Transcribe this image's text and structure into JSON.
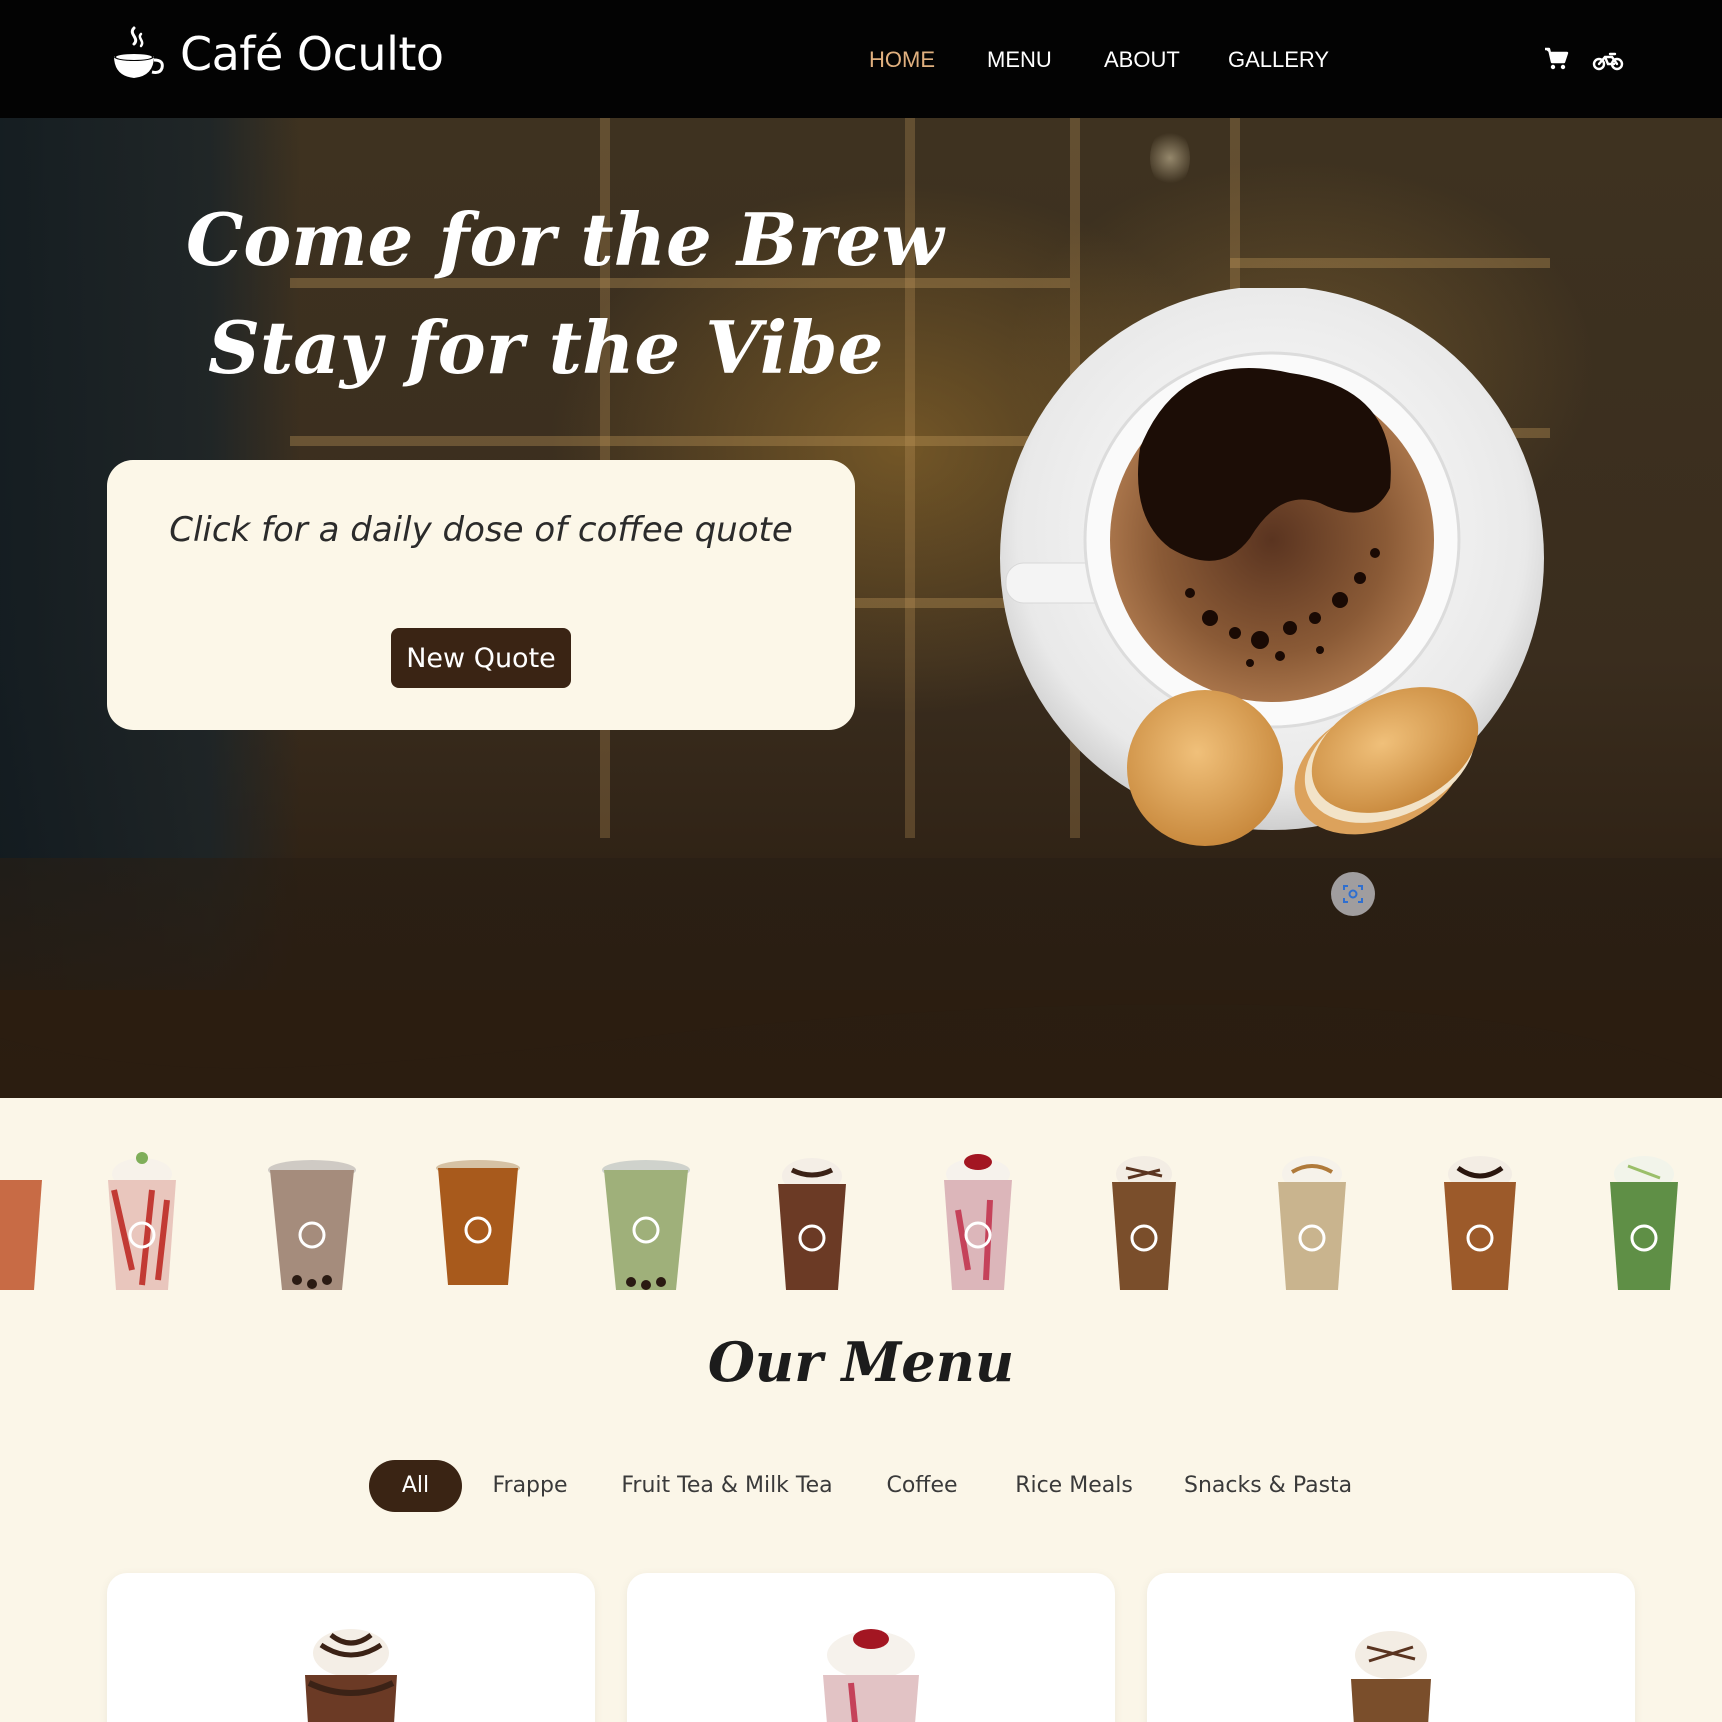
{
  "brand": {
    "name": "Café Oculto",
    "logo_icon": "coffee-cup-steam-icon"
  },
  "nav": {
    "items": [
      {
        "label": "HOME",
        "active": true
      },
      {
        "label": "MENU",
        "active": false
      },
      {
        "label": "ABOUT",
        "active": false
      },
      {
        "label": "GALLERY",
        "active": false
      }
    ],
    "icons": [
      "cart-icon",
      "motorcycle-icon"
    ]
  },
  "hero": {
    "title_line1": "Come for the Brew",
    "title_line2": "Stay for the Vibe",
    "quote_text": "Click for a daily dose of coffee quote",
    "quote_button": "New Quote",
    "image": "coffee-cup-with-cookies",
    "scan_icon": "visual-search-icon"
  },
  "drinks_strip": {
    "items": [
      "strawberry-frappe",
      "milk-tea-pearls",
      "fruit-tea",
      "matcha-milk-tea-pearls",
      "chocolate-frappe",
      "strawberry-cream-frappe",
      "mocha-frappe",
      "caramel-frappe",
      "java-chip-frappe",
      "matcha-frappe"
    ]
  },
  "menu": {
    "title": "Our Menu",
    "filters": [
      {
        "label": "All",
        "active": true
      },
      {
        "label": "Frappe",
        "active": false
      },
      {
        "label": "Fruit Tea & Milk Tea",
        "active": false
      },
      {
        "label": "Coffee",
        "active": false
      },
      {
        "label": "Rice Meals",
        "active": false
      },
      {
        "label": "Snacks & Pasta",
        "active": false
      }
    ],
    "cards": [
      "chocolate-frappe",
      "strawberry-frappe",
      "mocha-frappe"
    ]
  },
  "colors": {
    "nav_bg": "#030303",
    "nav_active": "#e0b07f",
    "page_bg": "#fbf6e8",
    "accent_dark": "#3a2414",
    "hero_bottom": "#2b1d10"
  }
}
